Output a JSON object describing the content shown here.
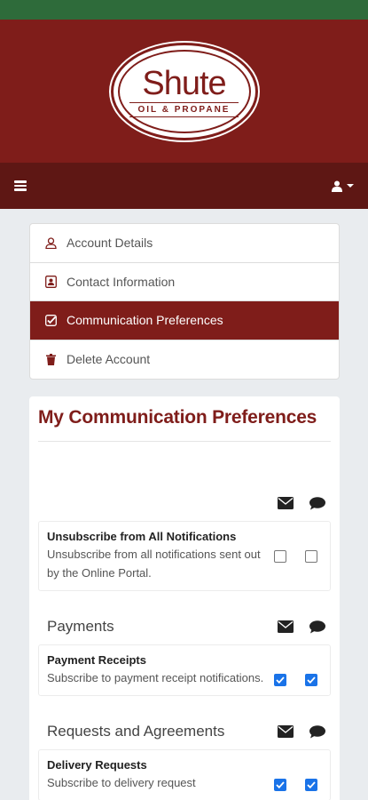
{
  "brand": {
    "logo_name": "Shute",
    "logo_sub": "OIL & PROPANE",
    "primary_color": "#7f1d1a",
    "nav_color": "#5e1714",
    "status_color": "#2e6b3a"
  },
  "navbar": {
    "menu_icon": "hamburger-icon",
    "user_icon": "user-icon"
  },
  "menu": {
    "items": [
      {
        "label": "Account Details",
        "icon": "user-outline-icon",
        "active": false
      },
      {
        "label": "Contact Information",
        "icon": "contact-card-icon",
        "active": false
      },
      {
        "label": "Communication Preferences",
        "icon": "checked-square-icon",
        "active": true
      },
      {
        "label": "Delete Account",
        "icon": "trash-icon",
        "active": false
      }
    ]
  },
  "preferences": {
    "title": "My Communication Preferences",
    "sections": [
      {
        "label": "",
        "items": [
          {
            "title": "Unsubscribe from All Notifications",
            "description": "Unsubscribe from all notifications sent out by the Online Portal.",
            "email": false,
            "sms": false
          }
        ]
      },
      {
        "label": "Payments",
        "items": [
          {
            "title": "Payment Receipts",
            "description": "Subscribe to payment receipt notifications.",
            "email": true,
            "sms": true
          }
        ]
      },
      {
        "label": "Requests and Agreements",
        "items": [
          {
            "title": "Delivery Requests",
            "description": "Subscribe to delivery request",
            "email": true,
            "sms": true
          }
        ]
      }
    ],
    "checkbox_color": "#1a73e8"
  }
}
